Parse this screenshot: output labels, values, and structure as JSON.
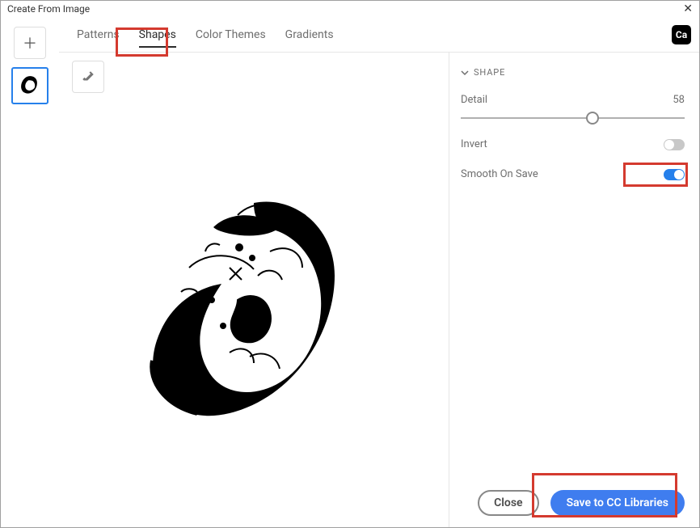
{
  "window": {
    "title": "Create From Image"
  },
  "tabs": {
    "patterns": "Patterns",
    "shapes": "Shapes",
    "color_themes": "Color Themes",
    "gradients": "Gradients",
    "active": "shapes",
    "ca_label": "Ca"
  },
  "panel": {
    "section_title": "SHAPE",
    "detail_label": "Detail",
    "detail_value": "58",
    "invert_label": "Invert",
    "invert_on": false,
    "smooth_label": "Smooth On Save",
    "smooth_on": true
  },
  "buttons": {
    "close": "Close",
    "save": "Save to CC Libraries"
  }
}
